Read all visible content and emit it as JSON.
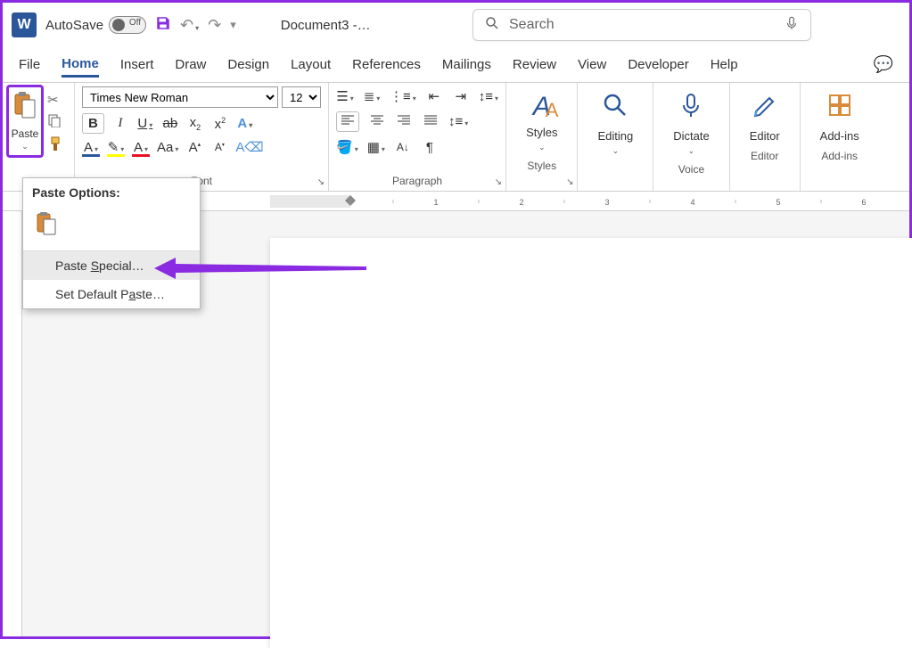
{
  "titlebar": {
    "autosave_label": "AutoSave",
    "autosave_state": "Off",
    "doc_title": "Document3 -…"
  },
  "search": {
    "placeholder": "Search"
  },
  "tabs": {
    "file": "File",
    "home": "Home",
    "insert": "Insert",
    "draw": "Draw",
    "design": "Design",
    "layout": "Layout",
    "references": "References",
    "mailings": "Mailings",
    "review": "Review",
    "view": "View",
    "developer": "Developer",
    "help": "Help"
  },
  "ribbon": {
    "clipboard": {
      "paste": "Paste"
    },
    "font": {
      "label": "Font",
      "name": "Times New Roman",
      "size": "12"
    },
    "paragraph": {
      "label": "Paragraph"
    },
    "styles": {
      "label": "Styles",
      "btn": "Styles"
    },
    "editing": {
      "btn": "Editing"
    },
    "dictate": {
      "btn": "Dictate",
      "label": "Voice"
    },
    "editor": {
      "btn": "Editor",
      "label": "Editor"
    },
    "addins": {
      "btn": "Add-ins",
      "label": "Add-ins"
    }
  },
  "paste_menu": {
    "header": "Paste Options:",
    "paste_special": "Paste Special…",
    "set_default": "Set Default Paste…"
  },
  "ruler": {
    "marks": [
      "1",
      "2",
      "3",
      "4",
      "5",
      "6"
    ]
  }
}
